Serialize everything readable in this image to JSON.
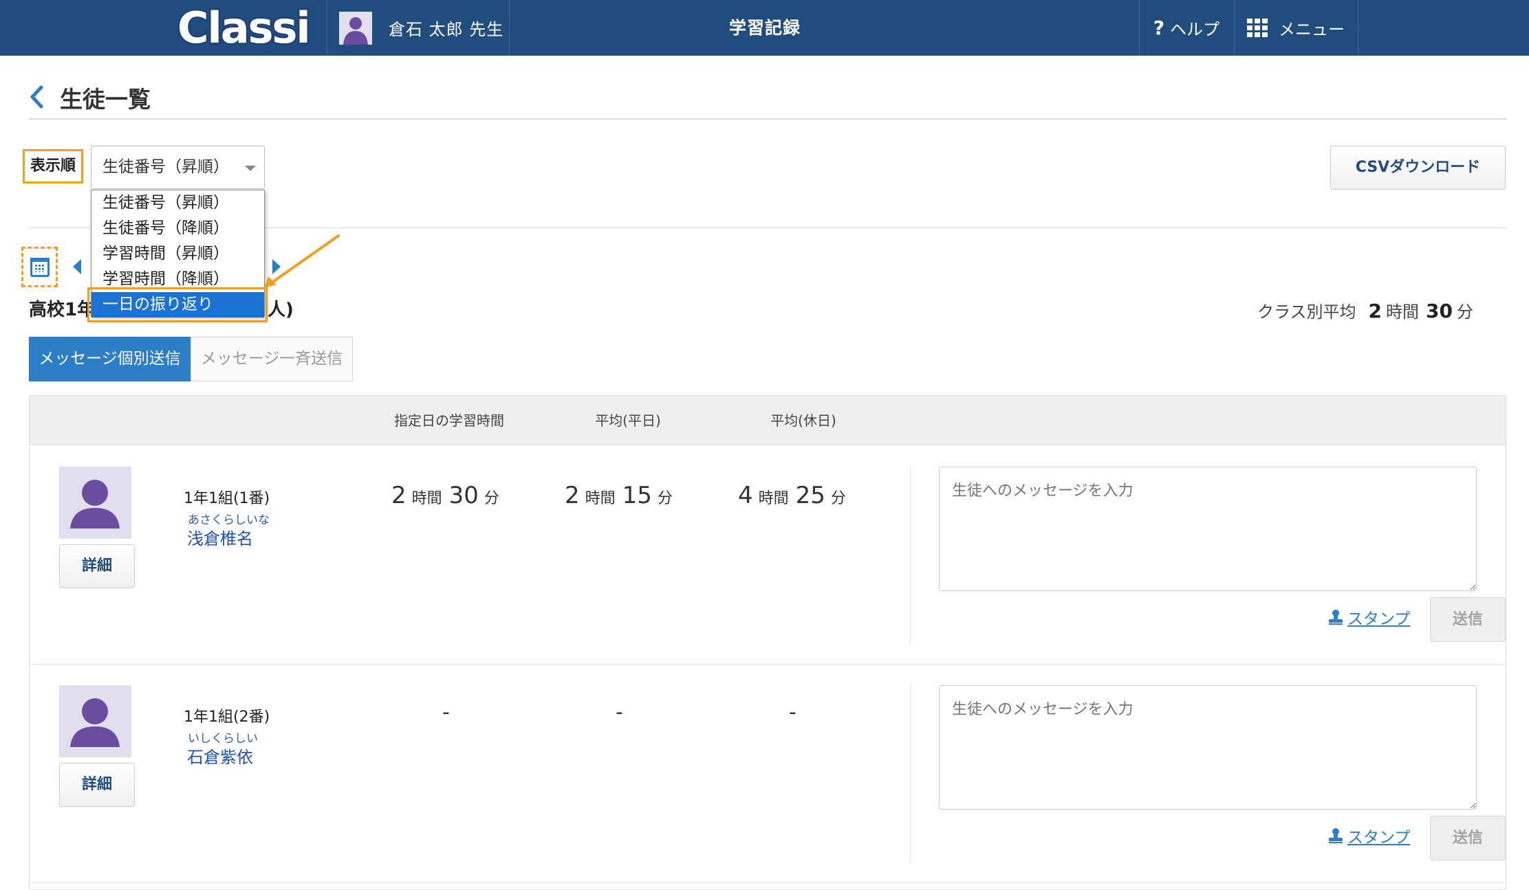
{
  "header": {
    "logo": "Classi",
    "user_name": "倉石 太郎 先生",
    "title": "学習記録",
    "help_label": "ヘルプ",
    "menu_label": "メニュー"
  },
  "page": {
    "title": "生徒一覧"
  },
  "sort": {
    "label": "表示順",
    "selected": "生徒番号（昇順）",
    "options": [
      "生徒番号（昇順）",
      "生徒番号（降順）",
      "学習時間（昇順）",
      "学習時間（降順）",
      "一日の振り返り"
    ],
    "highlighted_index": 4
  },
  "csv_button": "CSVダウンロード",
  "class_info": {
    "name_visible_start": "高校1年",
    "name_visible_end": "人)",
    "avg_label": "クラス別平均",
    "avg_hours": "2",
    "avg_hours_unit": "時間",
    "avg_minutes": "30",
    "avg_minutes_unit": "分"
  },
  "message_tabs": {
    "individual": "メッセージ個別送信",
    "bulk": "メッセージ一斉送信"
  },
  "table": {
    "columns": [
      "指定日の学習時間",
      "平均(平日)",
      "平均(休日)"
    ],
    "rows": [
      {
        "detail": "詳細",
        "class_number": "1年1組(1番)",
        "kana": "あさくらしいな",
        "name": "浅倉椎名",
        "day_time": {
          "h": "2",
          "hu": "時間",
          "m": "30",
          "mu": "分"
        },
        "weekday_avg": {
          "h": "2",
          "hu": "時間",
          "m": "15",
          "mu": "分"
        },
        "holiday_avg": {
          "h": "4",
          "hu": "時間",
          "m": "25",
          "mu": "分"
        },
        "message_placeholder": "生徒へのメッセージを入力",
        "stamp": "スタンプ",
        "send": "送信"
      },
      {
        "detail": "詳細",
        "class_number": "1年1組(2番)",
        "kana": "いしくらしい",
        "name": "石倉紫依",
        "day_time_dash": "-",
        "weekday_dash": "-",
        "holiday_dash": "-",
        "message_placeholder": "生徒へのメッセージを入力",
        "stamp": "スタンプ",
        "send": "送信"
      }
    ]
  },
  "colors": {
    "header_bg": "#204d7e",
    "accent_blue": "#2b7ec7",
    "highlight_orange": "#f0a01e",
    "dropdown_selected": "#1a73d4"
  }
}
